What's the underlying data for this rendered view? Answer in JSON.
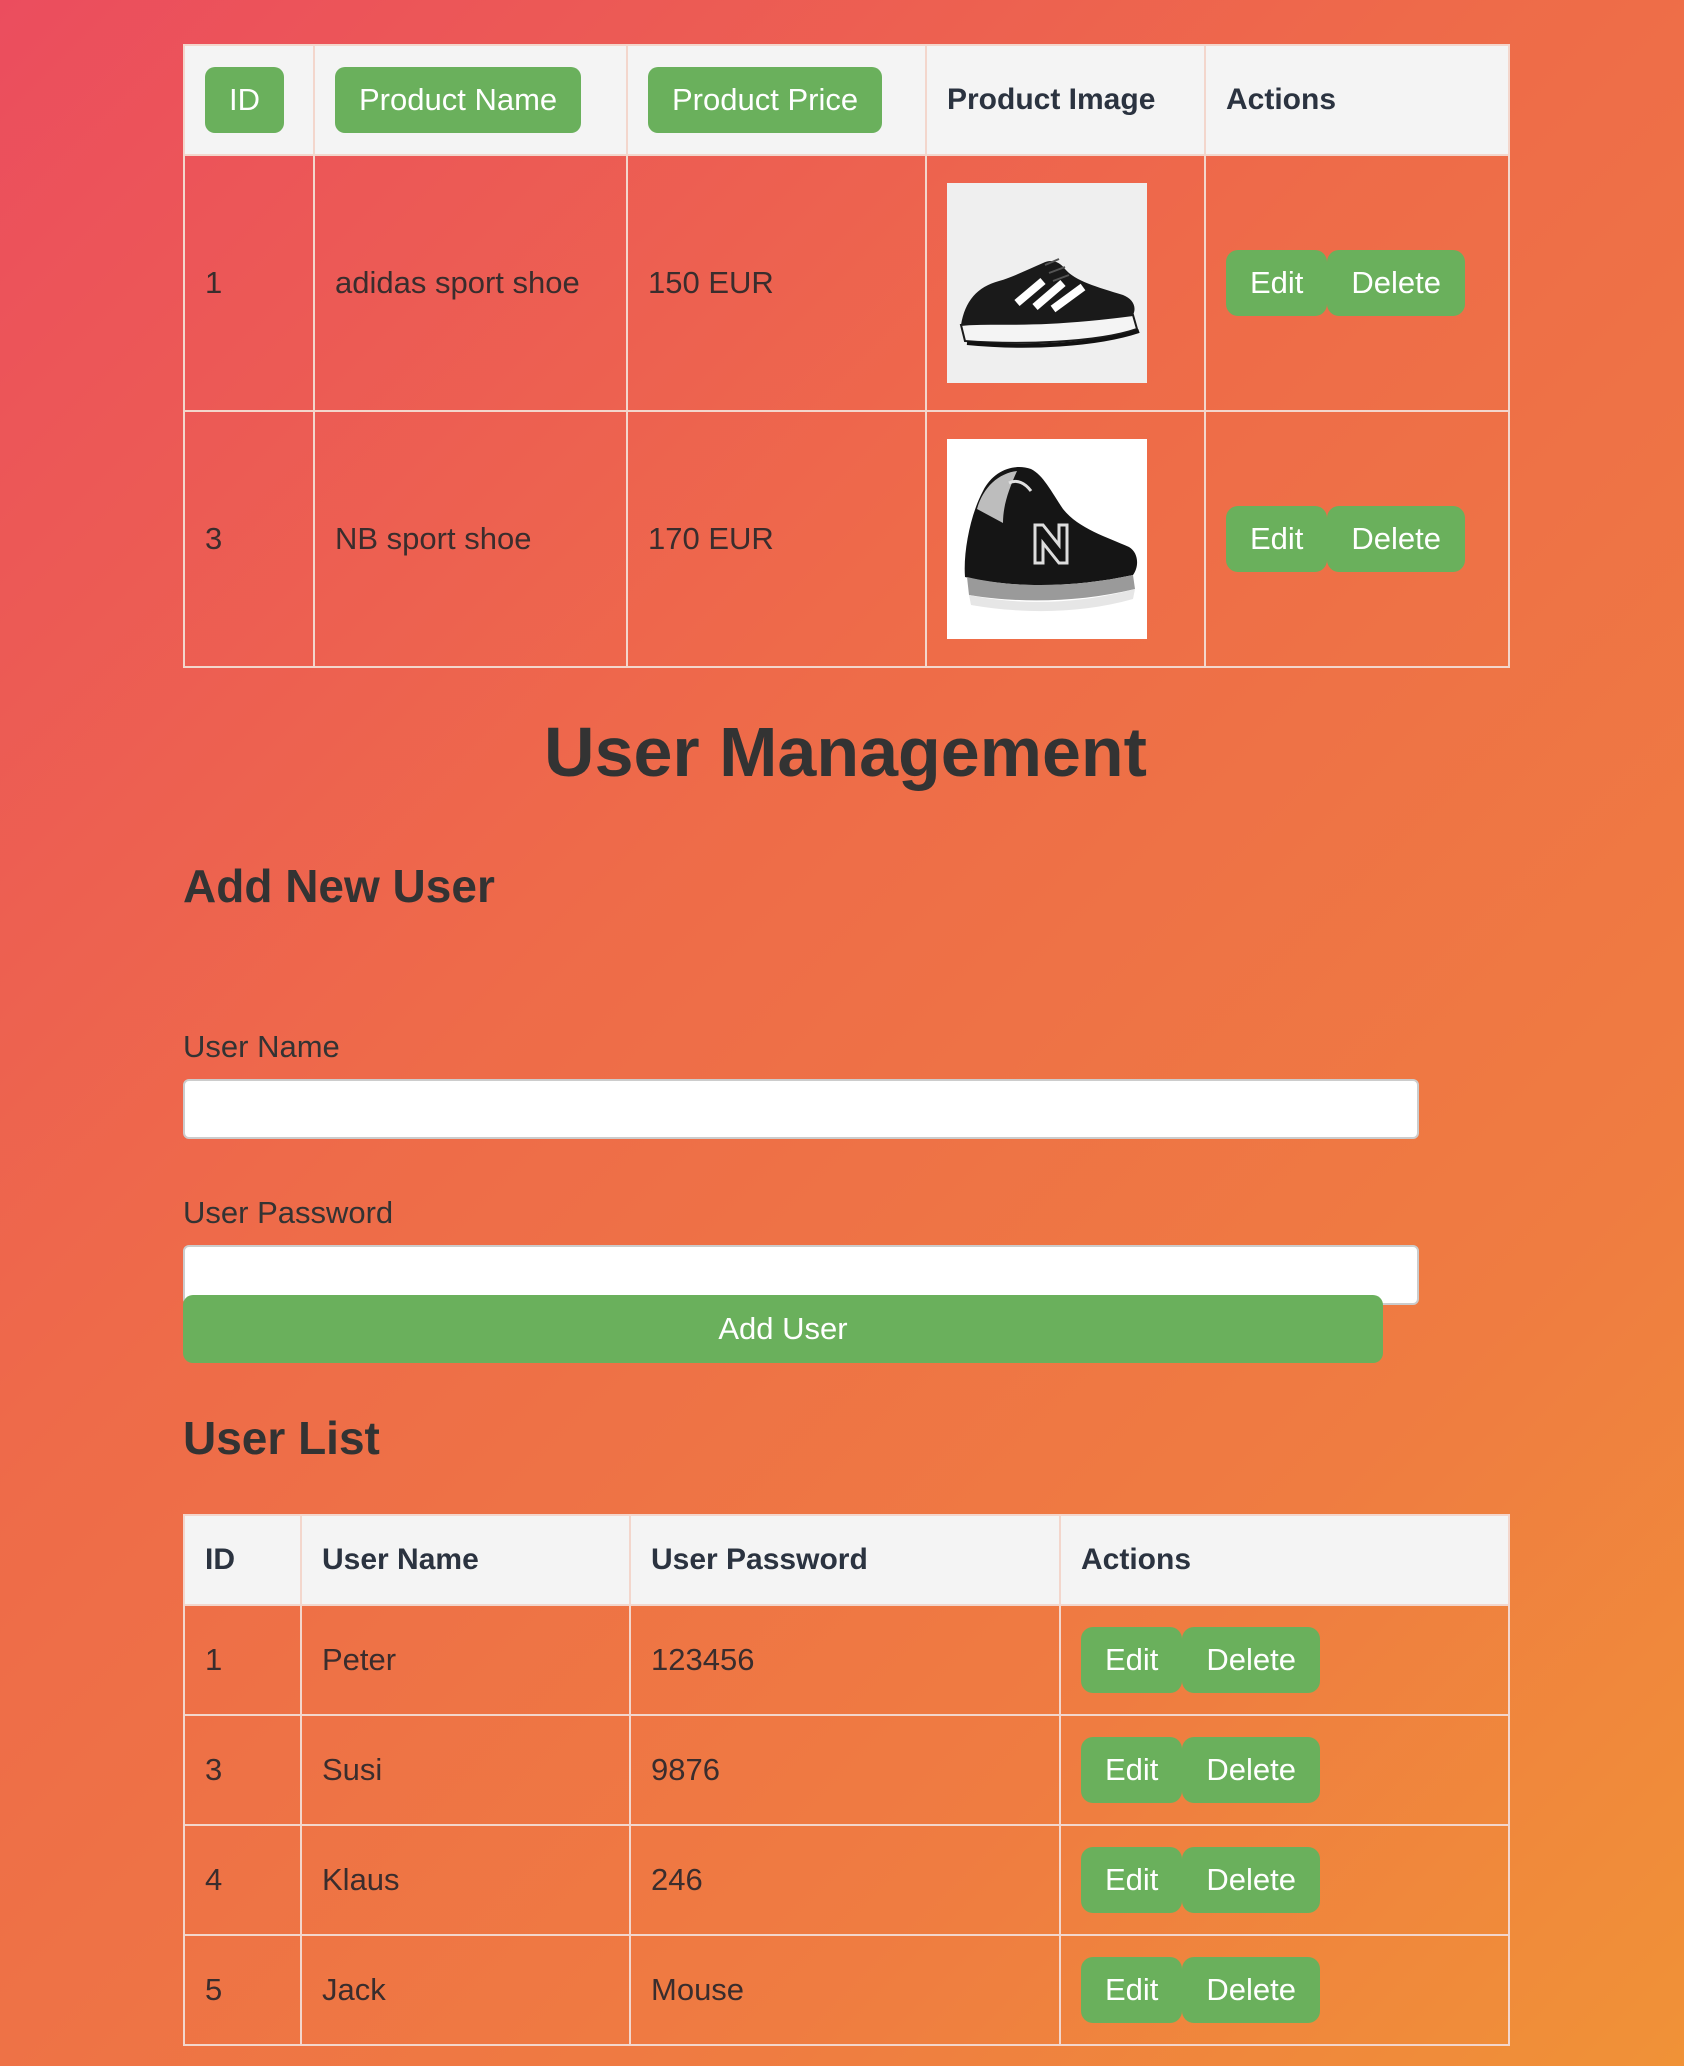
{
  "products": {
    "headers": {
      "id": "ID",
      "name": "Product Name",
      "price": "Product Price",
      "image": "Product Image",
      "actions": "Actions"
    },
    "rows": [
      {
        "id": "1",
        "name": "adidas sport shoe",
        "price": "150 EUR",
        "image_icon": "adidas-shoe-image"
      },
      {
        "id": "3",
        "name": "NB sport shoe",
        "price": "170 EUR",
        "image_icon": "nb-shoe-image"
      }
    ],
    "edit_label": "Edit",
    "delete_label": "Delete"
  },
  "user_management": {
    "title": "User Management",
    "add_section_title": "Add New User",
    "name_label": "User Name",
    "name_value": "",
    "password_label": "User Password",
    "password_value": "",
    "add_button": "Add User",
    "list_title": "User List"
  },
  "users": {
    "headers": {
      "id": "ID",
      "name": "User Name",
      "password": "User Password",
      "actions": "Actions"
    },
    "rows": [
      {
        "id": "1",
        "name": "Peter",
        "password": "123456"
      },
      {
        "id": "3",
        "name": "Susi",
        "password": "9876"
      },
      {
        "id": "4",
        "name": "Klaus",
        "password": "246"
      },
      {
        "id": "5",
        "name": "Jack",
        "password": "Mouse"
      }
    ],
    "edit_label": "Edit",
    "delete_label": "Delete"
  },
  "colors": {
    "accent_green": "#6ab05c",
    "header_bg": "#f4f4f4",
    "gradient_start": "#eb4d5e",
    "gradient_end": "#f09237"
  }
}
